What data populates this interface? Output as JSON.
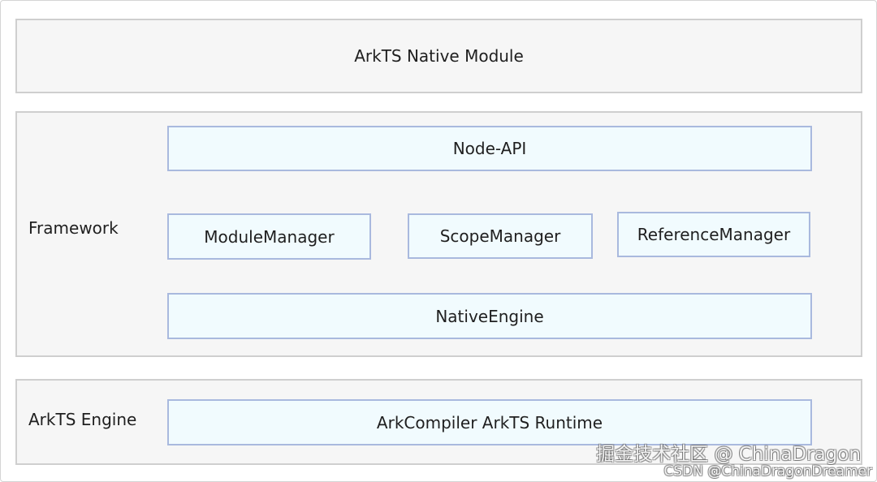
{
  "top_layer": {
    "title": "ArkTS Native Module"
  },
  "framework_layer": {
    "label": "Framework",
    "node_api": "Node-API",
    "module_manager": "ModuleManager",
    "scope_manager": "ScopeManager",
    "reference_manager": "ReferenceManager",
    "native_engine": "NativeEngine"
  },
  "engine_layer": {
    "label": "ArkTS Engine",
    "runtime": "ArkCompiler ArkTS Runtime"
  },
  "watermark": {
    "line1": "掘金技术社区 @ ChinaDragon",
    "line2": "CSDN @ChinaDragonDreamer"
  },
  "colors": {
    "layer_fill": "#f6f6f6",
    "layer_border": "#cfcfcf",
    "box_fill": "#f1fbfe",
    "box_border": "#a9b9de"
  }
}
